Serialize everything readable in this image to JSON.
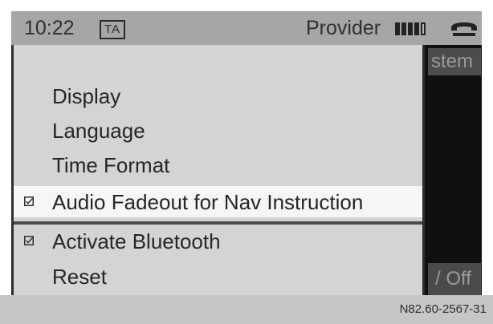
{
  "status_bar": {
    "time": "10:22",
    "ta_label": "TA",
    "provider": "Provider",
    "signal_bars_filled": 4,
    "signal_bars_total": 5,
    "phone_icon": "phone-handset-icon"
  },
  "background_screen": {
    "title_fragment": "stem",
    "bottom_fragment": "/ Off"
  },
  "menu": {
    "items": [
      {
        "label": "Display",
        "checkbox": false,
        "selected": false
      },
      {
        "label": "Language",
        "checkbox": false,
        "selected": false
      },
      {
        "label": "Time Format",
        "checkbox": false,
        "selected": false
      },
      {
        "label": "Audio Fadeout for Nav Instruction",
        "checkbox": true,
        "checked": true,
        "selected": true
      },
      {
        "label": "Activate Bluetooth",
        "checkbox": true,
        "checked": true,
        "selected": false
      },
      {
        "label": "Reset",
        "checkbox": false,
        "selected": false
      }
    ]
  },
  "footer": {
    "code": "N82.60-2567-31"
  },
  "colors": {
    "status_bar_bg": "#a6a6a6",
    "menu_bg": "#d4d4d4",
    "selected_bg": "#f6f6f6",
    "back_panel_bg": "#101010"
  }
}
